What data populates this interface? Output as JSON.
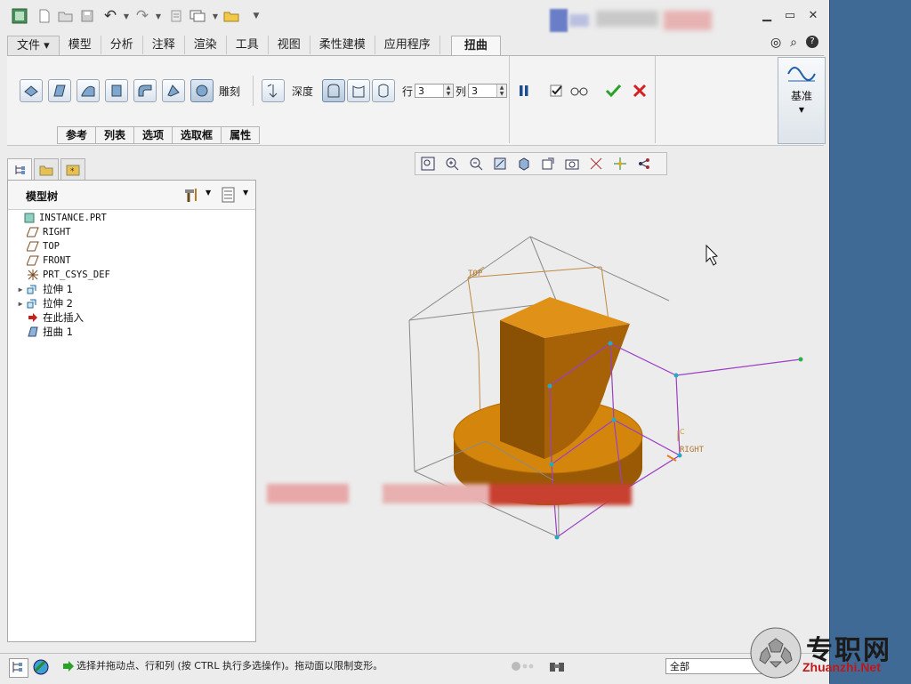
{
  "app": {
    "quick_access_icons": [
      "app-icon",
      "new-icon",
      "open-icon",
      "save-icon",
      "undo-icon",
      "redo-icon",
      "regenerate-icon",
      "windows-icon",
      "folder-icon",
      "customize-icon"
    ]
  },
  "ribbon": {
    "file_tab": "文件",
    "tabs": [
      "模型",
      "分析",
      "注释",
      "渲染",
      "工具",
      "视图",
      "柔性建模",
      "应用程序"
    ],
    "active_tab": "扭曲",
    "engrave_label": "雕刻",
    "depth_label": "深度",
    "rows_label": "行",
    "rows_value": "3",
    "cols_label": "列",
    "cols_value": "3",
    "subtabs": [
      "参考",
      "列表",
      "选项",
      "选取框",
      "属性"
    ],
    "datum_label": "基准"
  },
  "model_tree": {
    "title": "模型树",
    "items": [
      {
        "label": "INSTANCE.PRT",
        "icon": "part-icon",
        "expand": ""
      },
      {
        "label": "RIGHT",
        "icon": "datum-plane-icon",
        "expand": ""
      },
      {
        "label": "TOP",
        "icon": "datum-plane-icon",
        "expand": ""
      },
      {
        "label": "FRONT",
        "icon": "datum-plane-icon",
        "expand": ""
      },
      {
        "label": "PRT_CSYS_DEF",
        "icon": "csys-icon",
        "expand": ""
      },
      {
        "label": "拉伸 1",
        "icon": "extrude-icon",
        "expand": "▶"
      },
      {
        "label": "拉伸 2",
        "icon": "extrude-icon",
        "expand": "▶"
      },
      {
        "label": "在此插入",
        "icon": "insert-here-icon",
        "expand": ""
      },
      {
        "label": "扭曲 1",
        "icon": "warp-icon",
        "expand": ""
      }
    ]
  },
  "viewport": {
    "datum_labels": {
      "top": "TOP",
      "right": "RIGHT"
    },
    "colors": {
      "solid": "#d4860c",
      "solid_dark": "#9a5a05",
      "warp_box": "#9b3fc4",
      "datum": "#c08a40",
      "frame": "#8a8a8a"
    }
  },
  "status": {
    "message": "选择并拖动点、行和列 (按 CTRL 执行多选操作)。拖动面以限制变形。",
    "filter_value": "全部"
  },
  "watermark": {
    "cn": "专职网",
    "en": "Zhuanzhi.Net"
  }
}
